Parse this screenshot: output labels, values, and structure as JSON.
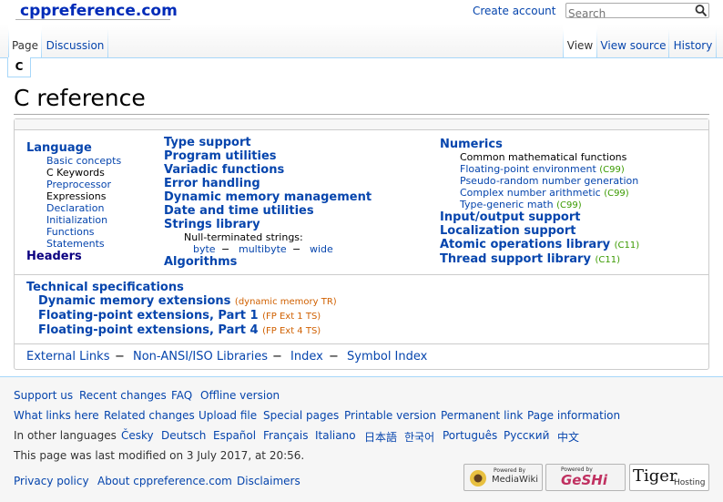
{
  "header": {
    "logo": "cppreference.com",
    "create_account": "Create account",
    "search_placeholder": "Search"
  },
  "tabs": {
    "page": "Page",
    "discussion": "Discussion",
    "view": "View",
    "view_source": "View source",
    "history": "History",
    "c": "C"
  },
  "main": {
    "title": "C reference",
    "col1": {
      "language": "Language",
      "items": [
        "Basic concepts",
        "C Keywords",
        "Preprocessor",
        "Expressions",
        "Declaration",
        "Initialization",
        "Functions",
        "Statements"
      ],
      "headers": "Headers"
    },
    "col2": {
      "type_support": "Type support",
      "program_utilities": "Program utilities",
      "variadic": "Variadic functions",
      "error_handling": "Error handling",
      "dynamic_memory": "Dynamic memory management",
      "date_time": "Date and time utilities",
      "strings": "Strings library",
      "null_term": "Null-terminated strings:",
      "byte": "byte",
      "multibyte": "multibyte",
      "wide": "wide",
      "dash": "−",
      "algorithms": "Algorithms"
    },
    "col3": {
      "numerics": "Numerics",
      "common_math": "Common mathematical functions",
      "fp_env": "Floating-point environment",
      "fp_env_ver": "(C99)",
      "prng": "Pseudo-random number generation",
      "complex": "Complex number arithmetic",
      "complex_ver": "(C99)",
      "tgmath": "Type-generic math",
      "tgmath_ver": "(C99)",
      "io": "Input/output support",
      "localization": "Localization support",
      "atomic": "Atomic operations library",
      "atomic_ver": "(C11)",
      "thread": "Thread support library",
      "thread_ver": "(C11)"
    },
    "tech": {
      "heading": "Technical specifications",
      "dyn_mem": "Dynamic memory extensions",
      "dyn_mem_tag": "(dynamic memory TR)",
      "fp1": "Floating-point extensions, Part 1",
      "fp1_tag": "(FP Ext 1 TS)",
      "fp4": "Floating-point extensions, Part 4",
      "fp4_tag": "(FP Ext 4 TS)"
    },
    "links": {
      "external": "External Links",
      "non_ansi": "Non-ANSI/ISO Libraries",
      "index": "Index",
      "symbol_index": "Symbol Index",
      "dash": "−"
    }
  },
  "footer": {
    "row1": [
      "Support us",
      "Recent changes",
      "FAQ",
      "Offline version"
    ],
    "row2": [
      "What links here",
      "Related changes",
      "Upload file",
      "Special pages",
      "Printable version",
      "Permanent link",
      "Page information"
    ],
    "other_langs_label": "In other languages",
    "langs": [
      "Česky",
      "Deutsch",
      "Español",
      "Français",
      "Italiano",
      "日本語",
      "한국어",
      "Português",
      "Русский",
      "中文"
    ],
    "last_modified": "This page was last modified on 3 July 2017, at 20:56.",
    "row5": [
      "Privacy policy",
      "About cppreference.com",
      "Disclaimers"
    ],
    "badges": {
      "mediawiki_top": "Powered By",
      "mediawiki": "MediaWiki",
      "geshi_top": "Powered by",
      "geshi": "GeSHi",
      "tiger": "Tiger",
      "tiger_sub": "Hosting"
    }
  }
}
